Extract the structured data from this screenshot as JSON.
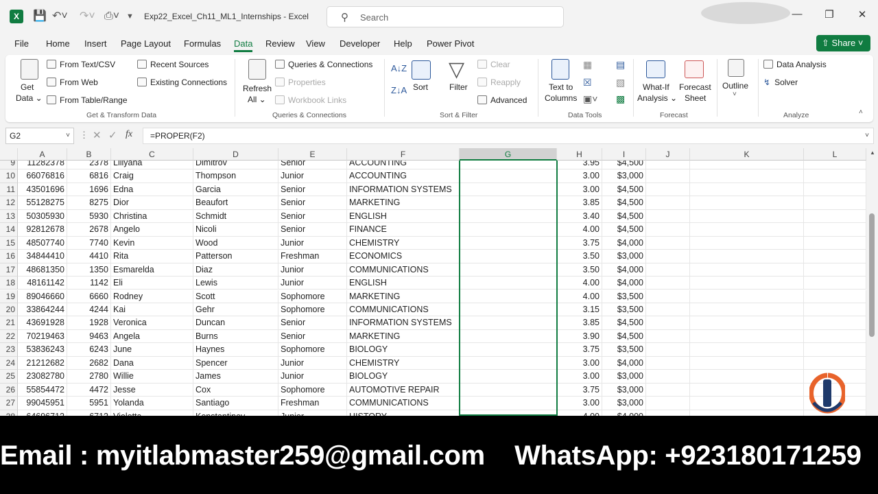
{
  "app": {
    "title": "Exp22_Excel_Ch11_ML1_Internships - Excel",
    "search_placeholder": "Search"
  },
  "tabs": [
    "File",
    "Home",
    "Insert",
    "Page Layout",
    "Formulas",
    "Data",
    "Review",
    "View",
    "Developer",
    "Help",
    "Power Pivot"
  ],
  "active_tab": "Data",
  "share_label": "Share",
  "ribbon": {
    "get_data": {
      "l1": "Get",
      "l2": "Data ⌄"
    },
    "from_text": "From Text/CSV",
    "from_web": "From Web",
    "from_table": "From Table/Range",
    "recent_sources": "Recent Sources",
    "existing_connections": "Existing Connections",
    "group_get_transform": "Get & Transform Data",
    "refresh": {
      "l1": "Refresh",
      "l2": "All ⌄"
    },
    "queries_connections": "Queries & Connections",
    "properties": "Properties",
    "workbook_links": "Workbook Links",
    "group_queries": "Queries & Connections",
    "sort": "Sort",
    "filter": "Filter",
    "clear": "Clear",
    "reapply": "Reapply",
    "advanced": "Advanced",
    "group_sort_filter": "Sort & Filter",
    "text_to_columns": {
      "l1": "Text to",
      "l2": "Columns"
    },
    "group_data_tools": "Data Tools",
    "what_if": {
      "l1": "What-If",
      "l2": "Analysis ⌄"
    },
    "forecast_sheet": {
      "l1": "Forecast",
      "l2": "Sheet"
    },
    "group_forecast": "Forecast",
    "outline": "Outline",
    "data_analysis": "Data Analysis",
    "solver": "Solver",
    "group_analyze": "Analyze"
  },
  "formula_bar": {
    "name_box": "G2",
    "formula": "=PROPER(F2)"
  },
  "columns": [
    "A",
    "B",
    "C",
    "D",
    "E",
    "F",
    "G",
    "H",
    "I",
    "J",
    "K",
    "L"
  ],
  "rows": [
    {
      "n": "9",
      "a": "11282378",
      "b": "2378",
      "c": "Liliyana",
      "d": "Dimitrov",
      "e": "Senior",
      "f": "ACCOUNTING",
      "h": "3.95",
      "i": "$4,500"
    },
    {
      "n": "10",
      "a": "66076816",
      "b": "6816",
      "c": "Craig",
      "d": "Thompson",
      "e": "Junior",
      "f": "ACCOUNTING",
      "h": "3.00",
      "i": "$3,000"
    },
    {
      "n": "11",
      "a": "43501696",
      "b": "1696",
      "c": "Edna",
      "d": "Garcia",
      "e": "Senior",
      "f": "INFORMATION SYSTEMS",
      "h": "3.00",
      "i": "$4,500"
    },
    {
      "n": "12",
      "a": "55128275",
      "b": "8275",
      "c": "Dior",
      "d": "Beaufort",
      "e": "Senior",
      "f": "MARKETING",
      "h": "3.85",
      "i": "$4,500"
    },
    {
      "n": "13",
      "a": "50305930",
      "b": "5930",
      "c": "Christina",
      "d": "Schmidt",
      "e": "Senior",
      "f": "ENGLISH",
      "h": "3.40",
      "i": "$4,500"
    },
    {
      "n": "14",
      "a": "92812678",
      "b": "2678",
      "c": "Angelo",
      "d": "Nicoli",
      "e": "Senior",
      "f": "FINANCE",
      "h": "4.00",
      "i": "$4,500"
    },
    {
      "n": "15",
      "a": "48507740",
      "b": "7740",
      "c": "Kevin",
      "d": "Wood",
      "e": "Junior",
      "f": "CHEMISTRY",
      "h": "3.75",
      "i": "$4,000"
    },
    {
      "n": "16",
      "a": "34844410",
      "b": "4410",
      "c": "Rita",
      "d": "Patterson",
      "e": "Freshman",
      "f": "ECONOMICS",
      "h": "3.50",
      "i": "$3,000"
    },
    {
      "n": "17",
      "a": "48681350",
      "b": "1350",
      "c": "Esmarelda",
      "d": "Diaz",
      "e": "Junior",
      "f": "COMMUNICATIONS",
      "h": "3.50",
      "i": "$4,000"
    },
    {
      "n": "18",
      "a": "48161142",
      "b": "1142",
      "c": "Eli",
      "d": "Lewis",
      "e": "Junior",
      "f": "ENGLISH",
      "h": "4.00",
      "i": "$4,000"
    },
    {
      "n": "19",
      "a": "89046660",
      "b": "6660",
      "c": "Rodney",
      "d": "Scott",
      "e": "Sophomore",
      "f": "MARKETING",
      "h": "4.00",
      "i": "$3,500"
    },
    {
      "n": "20",
      "a": "33864244",
      "b": "4244",
      "c": "Kai",
      "d": "Gehr",
      "e": "Sophomore",
      "f": "COMMUNICATIONS",
      "h": "3.15",
      "i": "$3,500"
    },
    {
      "n": "21",
      "a": "43691928",
      "b": "1928",
      "c": "Veronica",
      "d": "Duncan",
      "e": "Senior",
      "f": "INFORMATION SYSTEMS",
      "h": "3.85",
      "i": "$4,500"
    },
    {
      "n": "22",
      "a": "70219463",
      "b": "9463",
      "c": "Angela",
      "d": "Burns",
      "e": "Senior",
      "f": "MARKETING",
      "h": "3.90",
      "i": "$4,500"
    },
    {
      "n": "23",
      "a": "53836243",
      "b": "6243",
      "c": "June",
      "d": "Haynes",
      "e": "Sophomore",
      "f": "BIOLOGY",
      "h": "3.75",
      "i": "$3,500"
    },
    {
      "n": "24",
      "a": "21212682",
      "b": "2682",
      "c": "Dana",
      "d": "Spencer",
      "e": "Junior",
      "f": "CHEMISTRY",
      "h": "3.00",
      "i": "$4,000"
    },
    {
      "n": "25",
      "a": "23082780",
      "b": "2780",
      "c": "Willie",
      "d": "James",
      "e": "Junior",
      "f": "BIOLOGY",
      "h": "3.00",
      "i": "$3,000"
    },
    {
      "n": "26",
      "a": "55854472",
      "b": "4472",
      "c": "Jesse",
      "d": "Cox",
      "e": "Sophomore",
      "f": "AUTOMOTIVE REPAIR",
      "h": "3.75",
      "i": "$3,000"
    },
    {
      "n": "27",
      "a": "99045951",
      "b": "5951",
      "c": "Yolanda",
      "d": "Santiago",
      "e": "Freshman",
      "f": "COMMUNICATIONS",
      "h": "3.00",
      "i": "$3,000"
    },
    {
      "n": "28",
      "a": "64696712",
      "b": "6712",
      "c": "Violetta",
      "d": "Konstantinov",
      "e": "Junior",
      "f": "HISTORY",
      "h": "4.00",
      "i": "$4,000"
    }
  ],
  "banner": "Email : myitlabmaster259@gmail.com    WhatsApp: +923180171259",
  "colors": {
    "accent": "#107c41"
  }
}
